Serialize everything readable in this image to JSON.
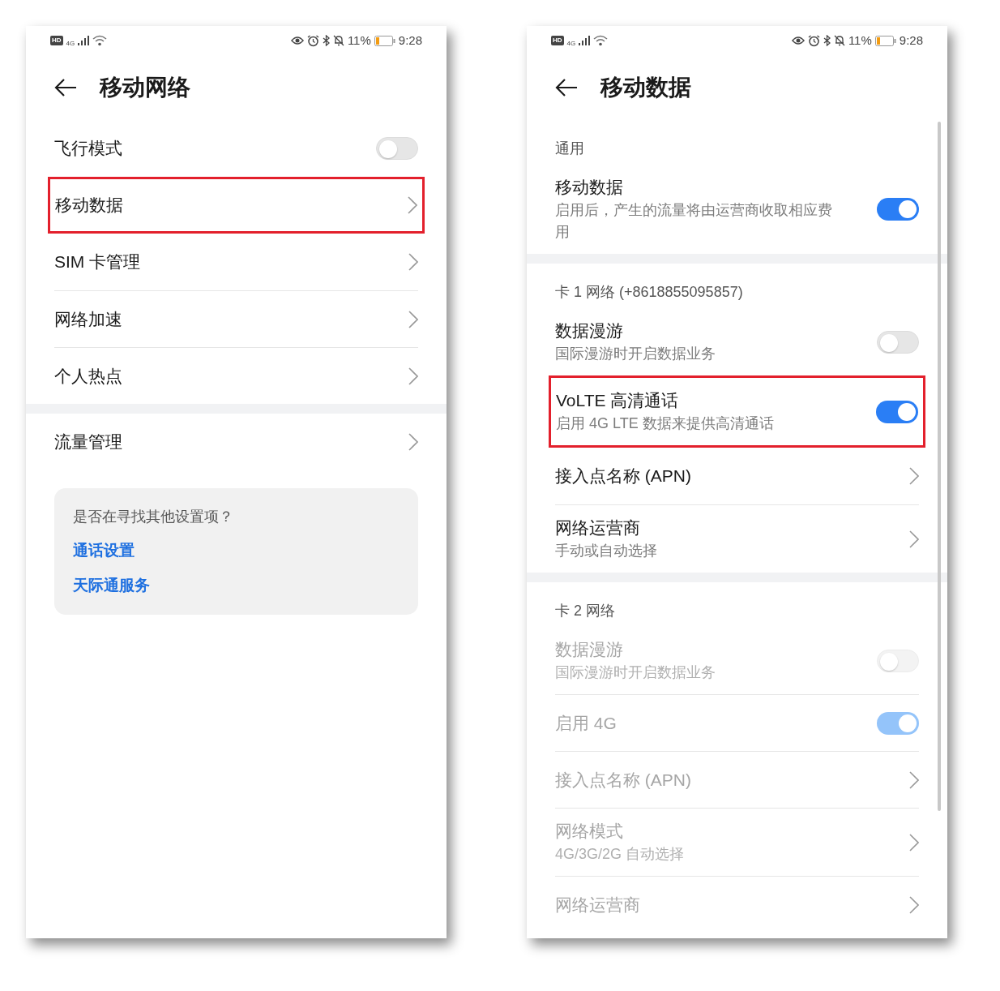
{
  "screens": [
    {
      "status_bar": {
        "hd": "HD",
        "network": "4G",
        "battery_percent": "11%",
        "time": "9:28"
      },
      "title": "移动网络",
      "groups": [
        {
          "items": [
            {
              "kind": "toggle",
              "title": "飞行模式",
              "on": false,
              "disabled": false,
              "highlighted": false
            },
            {
              "kind": "link",
              "title": "移动数据",
              "disabled": false,
              "highlighted": true
            },
            {
              "kind": "link",
              "title": "SIM 卡管理",
              "disabled": false,
              "highlighted": false
            },
            {
              "kind": "link",
              "title": "网络加速",
              "disabled": false,
              "highlighted": false
            },
            {
              "kind": "link",
              "title": "个人热点",
              "disabled": false,
              "highlighted": false
            }
          ]
        },
        {
          "items": [
            {
              "kind": "link",
              "title": "流量管理",
              "disabled": false,
              "highlighted": false
            }
          ]
        }
      ],
      "tip_card": {
        "question": "是否在寻找其他设置项？",
        "links": [
          "通话设置",
          "天际通服务"
        ]
      }
    },
    {
      "status_bar": {
        "hd": "HD",
        "network": "4G",
        "battery_percent": "11%",
        "time": "9:28"
      },
      "title": "移动数据",
      "groups": [
        {
          "header": "通用",
          "items": [
            {
              "kind": "toggle",
              "title": "移动数据",
              "subtitle": "启用后，产生的流量将由运营商收取相应费用",
              "on": true,
              "disabled": false,
              "highlighted": false
            }
          ]
        },
        {
          "header": "卡 1 网络 (+8618855095857)",
          "items": [
            {
              "kind": "toggle",
              "title": "数据漫游",
              "subtitle": "国际漫游时开启数据业务",
              "on": false,
              "disabled": false,
              "highlighted": false
            },
            {
              "kind": "toggle",
              "title": "VoLTE 高清通话",
              "subtitle": "启用 4G LTE 数据来提供高清通话",
              "on": true,
              "disabled": false,
              "highlighted": true
            },
            {
              "kind": "link",
              "title": "接入点名称 (APN)",
              "disabled": false,
              "highlighted": false
            },
            {
              "kind": "link",
              "title": "网络运营商",
              "subtitle": "手动或自动选择",
              "disabled": false,
              "highlighted": false
            }
          ]
        },
        {
          "header": "卡 2 网络",
          "items": [
            {
              "kind": "toggle",
              "title": "数据漫游",
              "subtitle": "国际漫游时开启数据业务",
              "on": false,
              "disabled": true,
              "highlighted": false
            },
            {
              "kind": "toggle",
              "title": "启用 4G",
              "on": true,
              "disabled": true,
              "highlighted": false
            },
            {
              "kind": "link",
              "title": "接入点名称 (APN)",
              "disabled": true,
              "highlighted": false
            },
            {
              "kind": "link",
              "title": "网络模式",
              "subtitle": "4G/3G/2G 自动选择",
              "disabled": true,
              "highlighted": false
            },
            {
              "kind": "link",
              "title": "网络运营商",
              "disabled": true,
              "highlighted": false
            }
          ]
        }
      ]
    }
  ]
}
